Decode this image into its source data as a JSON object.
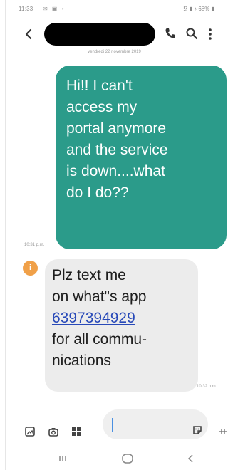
{
  "status_bar": {
    "time": "11:33",
    "left_icons": "✉ ▣ • ···",
    "right_text": "⁉ ▮ ♪ 68% ▮"
  },
  "header": {
    "contact_name": "",
    "back_icon": "arrow-back",
    "call_icon": "phone",
    "search_icon": "search",
    "more_icon": "more-vertical"
  },
  "conversation": {
    "date_label": "vendredi 22 novembre 2019",
    "sent_message": {
      "lines": [
        "Hi!! I can't",
        "access my",
        "portal anymore",
        "and the service",
        "is down....what",
        "do I do??"
      ],
      "time": "10:31 p.m."
    },
    "received_message": {
      "avatar_letter": "i",
      "lines_before_link": [
        "Plz text me",
        "on what\"s app"
      ],
      "link": "6397394929",
      "lines_after_link": [
        "for all commu-",
        "nications"
      ],
      "time": "10:32 p.m."
    }
  },
  "composer": {
    "input_value": "",
    "placeholder": ""
  },
  "colors": {
    "sent_bubble": "#2b9b8a",
    "received_bubble": "#ececec",
    "link": "#2849b8",
    "avatar": "#f0a048"
  }
}
